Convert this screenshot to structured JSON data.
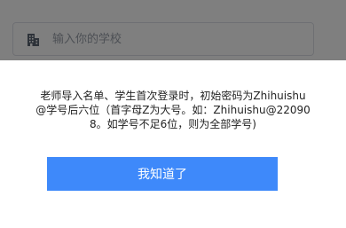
{
  "school_search": {
    "placeholder": "输入你的学校",
    "icon": "building-icon"
  },
  "dialog": {
    "message": "老师导入名单、学生首次登录时，初始密码为Zhihuishu@学号后六位（首字母Z为大号。如：Zhihuishu@220908。如学号不足6位，则为全部学号)",
    "confirm_label": "我知道了",
    "confirm_color": "#3e89fa"
  }
}
